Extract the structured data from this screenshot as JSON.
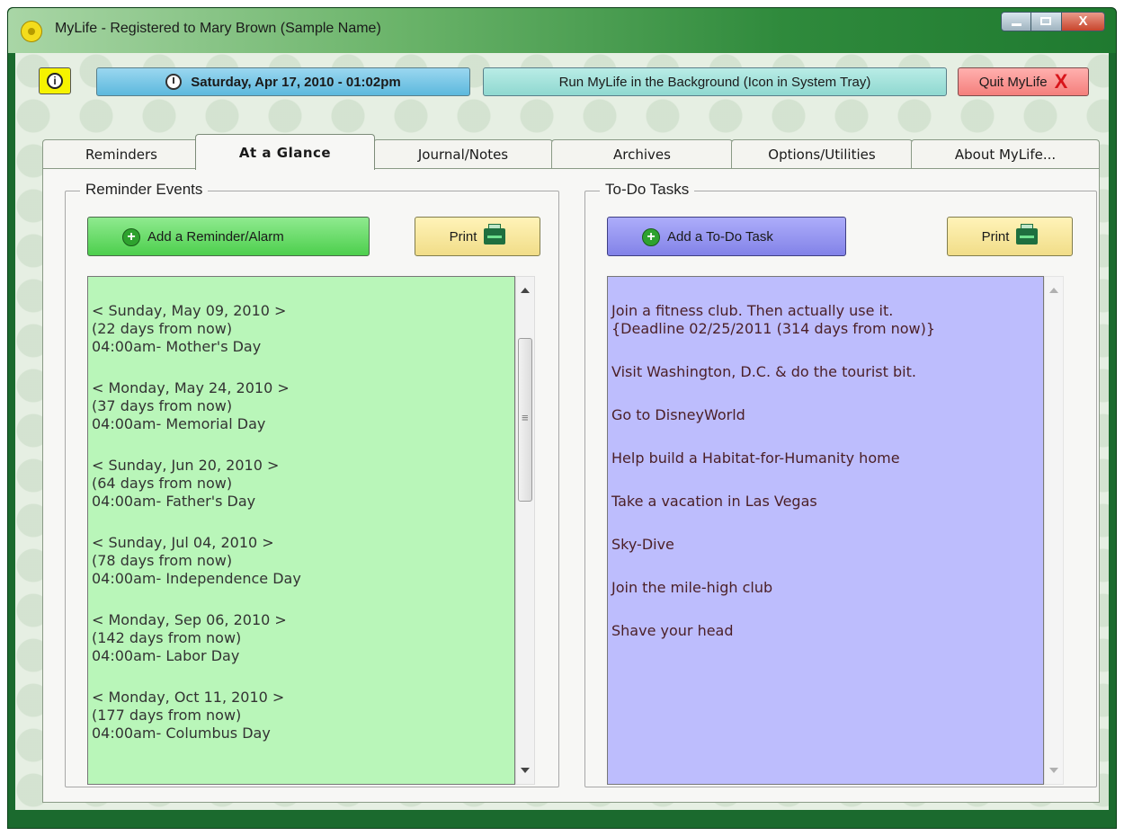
{
  "window": {
    "title": "MyLife - Registered to Mary Brown (Sample Name)",
    "close_glyph": "X"
  },
  "topbar": {
    "info_glyph": "i",
    "date_text": "Saturday, Apr 17, 2010 - 01:02pm",
    "background_btn": "Run MyLife in the Background (Icon in System Tray)",
    "quit_btn": "Quit MyLife",
    "quit_glyph": "X"
  },
  "tabs": [
    {
      "label": "Reminders"
    },
    {
      "label": "At a Glance"
    },
    {
      "label": "Journal/Notes"
    },
    {
      "label": "Archives"
    },
    {
      "label": "Options/Utilities"
    },
    {
      "label": "About MyLife..."
    }
  ],
  "reminders": {
    "legend": "Reminder Events",
    "add_btn": "Add a Reminder/Alarm",
    "print_btn": "Print",
    "items": [
      {
        "date": "< Sunday, May 09, 2010 >",
        "from_now": "(22 days from now)",
        "event": "04:00am- Mother's Day"
      },
      {
        "date": "< Monday, May 24, 2010 >",
        "from_now": "(37 days from now)",
        "event": "04:00am- Memorial Day"
      },
      {
        "date": "< Sunday, Jun 20, 2010 >",
        "from_now": "(64 days from now)",
        "event": "04:00am- Father's Day"
      },
      {
        "date": "< Sunday, Jul 04, 2010 >",
        "from_now": "(78 days from now)",
        "event": "04:00am- Independence Day"
      },
      {
        "date": "< Monday, Sep 06, 2010 >",
        "from_now": "(142 days from now)",
        "event": "04:00am- Labor Day"
      },
      {
        "date": "< Monday, Oct 11, 2010 >",
        "from_now": "(177 days from now)",
        "event": "04:00am- Columbus Day"
      }
    ]
  },
  "todos": {
    "legend": "To-Do Tasks",
    "add_btn": "Add a To-Do Task",
    "print_btn": "Print",
    "items": [
      {
        "text": "Join a fitness club.  Then actually use it.",
        "note": "{Deadline 02/25/2011 (314 days from now)}"
      },
      {
        "text": "Visit Washington, D.C. & do the tourist bit."
      },
      {
        "text": "Go to DisneyWorld"
      },
      {
        "text": "Help build a Habitat-for-Humanity home"
      },
      {
        "text": "Take a vacation in Las Vegas"
      },
      {
        "text": "Sky-Dive"
      },
      {
        "text": "Join the mile-high club"
      },
      {
        "text": "Shave your head"
      }
    ]
  },
  "colors": {
    "frame": "#1b6a2e",
    "reminder_bg": "#b9f6b9",
    "todo_bg": "#bdbdfd",
    "quit_bg": "#f47f7c",
    "date_bg": "#5db9dd"
  }
}
